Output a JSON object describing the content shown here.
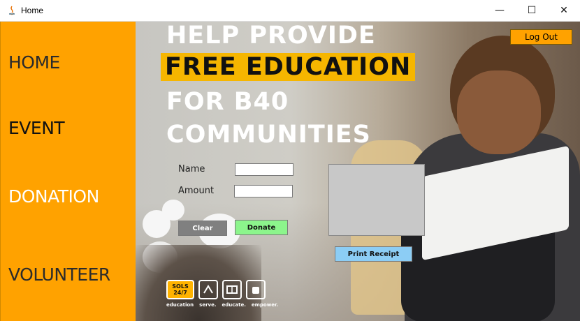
{
  "window": {
    "title": "Home",
    "controls": {
      "minimize": "—",
      "maximize": "☐",
      "close": "✕"
    }
  },
  "sidebar": {
    "items": [
      {
        "label": "HOME",
        "color": "#2b2b2b"
      },
      {
        "label": "EVENT",
        "color": "#111111"
      },
      {
        "label": "DONATION",
        "color": "#ffffff"
      },
      {
        "label": "VOLUNTEER",
        "color": "#2b2b2b"
      }
    ]
  },
  "banner": {
    "line1": "HELP PROVIDE",
    "line2": "FREE EDUCATION",
    "line3": "FOR B40",
    "line4": "COMMUNITIES"
  },
  "form": {
    "name_label": "Name",
    "amount_label": "Amount",
    "name_value": "",
    "amount_value": "",
    "clear_label": "Clear",
    "donate_label": "Donate",
    "print_label": "Print Receipt"
  },
  "header": {
    "logout_label": "Log Out"
  },
  "logos": {
    "main": "SOLS 24/7",
    "captions": [
      "education",
      "serve.",
      "educate.",
      "empower."
    ]
  },
  "colors": {
    "sidebar": "#ffa200",
    "highlight": "#f6b600",
    "clear_button": "#808080",
    "donate_button": "#8cf58c",
    "print_button": "#8ccdf5"
  }
}
